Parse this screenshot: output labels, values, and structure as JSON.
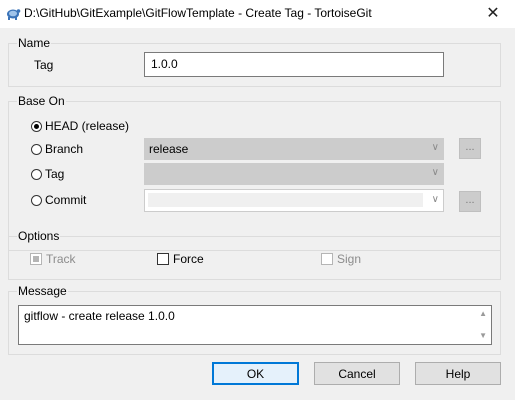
{
  "window": {
    "title": "D:\\GitHub\\GitExample\\GitFlowTemplate - Create Tag - TortoiseGit",
    "close_glyph": "✕",
    "app_icon": "tortoisegit-icon"
  },
  "name_group": {
    "label": "Name",
    "tag_label": "Tag",
    "tag_value": "1.0.0"
  },
  "base_on": {
    "label": "Base On",
    "head_label": "HEAD (release)",
    "branch_label": "Branch",
    "branch_value": "release",
    "tag_label": "Tag",
    "tag_value": "",
    "commit_label": "Commit",
    "commit_value": "",
    "browse_label": "...",
    "dropdown_glyph": "∨",
    "selected": "head"
  },
  "options": {
    "label": "Options",
    "track_label": "Track",
    "force_label": "Force",
    "sign_label": "Sign"
  },
  "message": {
    "label": "Message",
    "text": "gitflow - create release 1.0.0",
    "scroll_up_glyph": "▲",
    "scroll_down_glyph": "▼"
  },
  "buttons": {
    "ok": "OK",
    "cancel": "Cancel",
    "help": "Help"
  }
}
